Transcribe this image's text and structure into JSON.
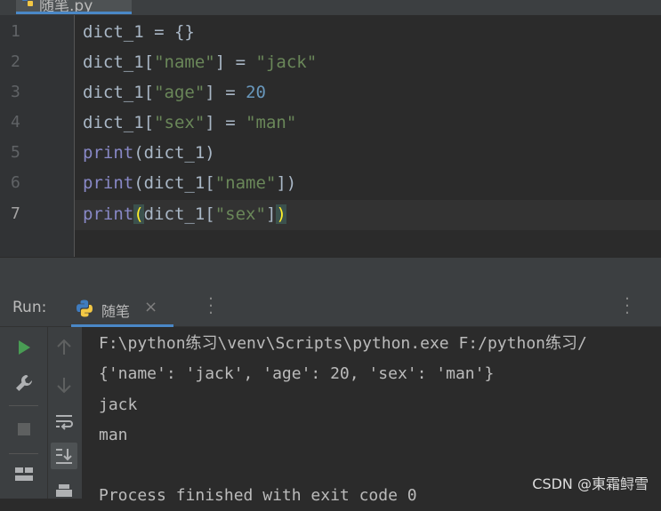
{
  "editor": {
    "tab": {
      "label": "随笔.py"
    },
    "line_numbers": [
      "1",
      "2",
      "3",
      "4",
      "5",
      "6",
      "7"
    ],
    "lines": [
      {
        "name": "dict_1",
        "op": " = ",
        "rest": "{}"
      },
      {
        "name": "dict_1",
        "open": "[",
        "key": "\"name\"",
        "close": "]",
        "op": " = ",
        "value": "\"jack\""
      },
      {
        "name": "dict_1",
        "open": "[",
        "key": "\"age\"",
        "close": "]",
        "op": " = ",
        "value": "20"
      },
      {
        "name": "dict_1",
        "open": "[",
        "key": "\"sex\"",
        "close": "]",
        "op": " = ",
        "value": "\"man\""
      },
      {
        "func": "print",
        "args": "(dict_1)"
      },
      {
        "func": "print",
        "open": "(dict_1[",
        "key": "\"name\"",
        "close": "])"
      },
      {
        "func": "print",
        "paren_open": "(",
        "mid": "dict_1[",
        "key": "\"sex\"",
        "bracket_close": "]",
        "paren_close": ")"
      }
    ]
  },
  "run_panel": {
    "title": "Run:",
    "tab_label": "随笔",
    "close_glyph": "×",
    "output": [
      "F:\\python练习\\venv\\Scripts\\python.exe F:/python练习/",
      "{'name': 'jack', 'age': 20, 'sex': 'man'}",
      "jack",
      "man",
      "",
      "Process finished with exit code 0"
    ],
    "tools": {
      "run": "run-icon",
      "settings": "wrench-icon",
      "stop": "stop-icon",
      "layout": "layout-icon",
      "up": "arrow-up-icon",
      "down": "arrow-down-icon",
      "wrap": "soft-wrap-icon",
      "scroll_end": "scroll-to-end-icon",
      "print": "print-icon"
    }
  },
  "watermark": "CSDN @東霜鲟雪",
  "colors": {
    "background": "#2b2b2b",
    "string": "#6a8759",
    "number": "#6897bb",
    "builtin": "#8888c6",
    "run_green": "#499c54",
    "accent": "#4a88c7"
  }
}
